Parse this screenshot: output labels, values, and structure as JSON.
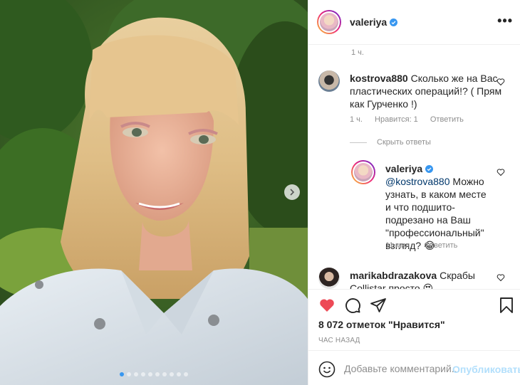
{
  "post": {
    "username": "valeriya",
    "more_label": "•••",
    "caption_time": "1 ч."
  },
  "comments": [
    {
      "username": "kostrova880",
      "text": "Сколько же на Вас пластических операций!? ( Прям как Гурченко !)",
      "time": "1 ч.",
      "likes": "Нравится: 1",
      "reply_label": "Ответить"
    }
  ],
  "hide_replies_label": "Скрыть ответы",
  "reply": {
    "username": "valeriya",
    "mention": "@kostrova880",
    "text": "Можно узнать, в каком месте и что подшито-подрезано на Ваш \"профессиональный\" взгляд?",
    "emoji": "😂",
    "time": "11 мин.",
    "reply_label": "Ответить"
  },
  "partial_comment": {
    "username": "marikabdrazakova",
    "text": "Скрабы Collistar просто",
    "emoji": "😍"
  },
  "likes_text": "8 072 отметок \"Нравится\"",
  "timeago": "ЧАС НАЗАД",
  "comment_box": {
    "placeholder": "Добавьте комментарий...",
    "publish_label": "Опубликовать"
  },
  "carousel": {
    "total": 10,
    "active_index": 0
  },
  "colors": {
    "accent": "#3897f0",
    "like": "#ed4956",
    "publish_disabled": "#b2dffc",
    "secondary_text": "#8e8e8e"
  }
}
